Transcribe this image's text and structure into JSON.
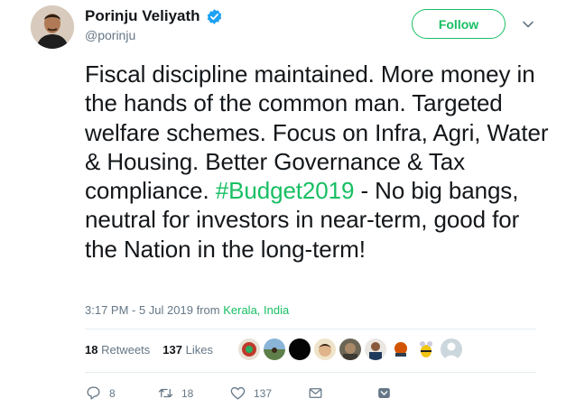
{
  "user": {
    "name": "Porinju Veliyath",
    "handle": "@porinju"
  },
  "follow_label": "Follow",
  "tweet": {
    "text_before": "Fiscal discipline maintained. More money in the hands of the common man. Targeted welfare schemes. Focus on Infra, Agri, Water & Housing. Better Governance & Tax compliance. ",
    "hashtag": "#Budget2019",
    "text_after": " - No big bangs, neutral for investors in near-term, good for the Nation in the long-term!"
  },
  "meta": {
    "timestamp": "3:17 PM - 5 Jul 2019",
    "from": "from",
    "location": "Kerala, India"
  },
  "stats": {
    "retweets_count": "18",
    "retweets_label": "Retweets",
    "likes_count": "137",
    "likes_label": "Likes"
  },
  "actions": {
    "replies": "8",
    "retweets": "18",
    "likes": "137"
  },
  "colors": {
    "accent": "#17bf63",
    "verified": "#1da1f2",
    "muted": "#657786"
  }
}
